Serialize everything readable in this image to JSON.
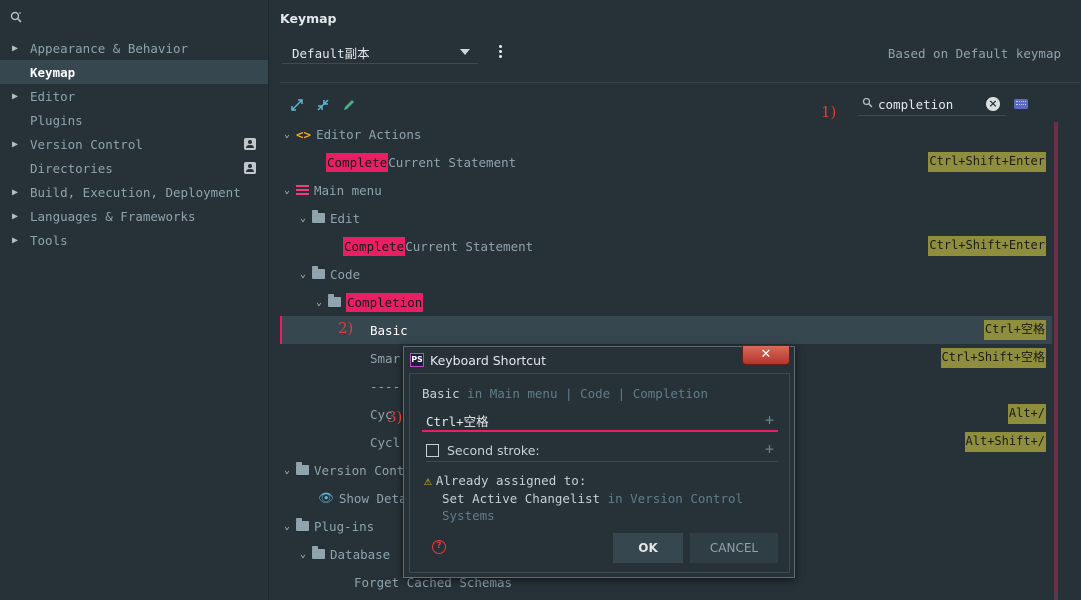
{
  "sidebar": {
    "search_icon": "search-icon",
    "items": [
      {
        "label": "Appearance & Behavior",
        "expandable": true
      },
      {
        "label": "Keymap",
        "expandable": false,
        "active": true
      },
      {
        "label": "Editor",
        "expandable": true
      },
      {
        "label": "Plugins",
        "expandable": false
      },
      {
        "label": "Version Control",
        "expandable": true,
        "badge": true
      },
      {
        "label": "Directories",
        "expandable": false,
        "badge": true
      },
      {
        "label": "Build, Execution, Deployment",
        "expandable": true
      },
      {
        "label": "Languages & Frameworks",
        "expandable": true
      },
      {
        "label": "Tools",
        "expandable": true
      }
    ]
  },
  "header": {
    "title": "Keymap",
    "keymap_value": "Default副本",
    "based_on": "Based on Default keymap"
  },
  "search": {
    "value": "completion"
  },
  "annotations": {
    "a1": "1)",
    "a2": "2)",
    "a3": "3)"
  },
  "tree": {
    "editor_actions": "Editor Actions",
    "row_complete_1": {
      "hl": "Complete",
      "rest": " Current Statement",
      "shortcut": "Ctrl+Shift+Enter"
    },
    "main_menu": "Main menu",
    "edit": "Edit",
    "row_complete_2": {
      "hl": "Complete",
      "rest": " Current Statement",
      "shortcut": "Ctrl+Shift+Enter"
    },
    "code": "Code",
    "completion": "Completion",
    "basic": {
      "label": "Basic",
      "shortcut": "Ctrl+空格"
    },
    "smart": {
      "label": "Smar",
      "shortcut": "Ctrl+Shift+空格"
    },
    "separator": "----",
    "cycle1": {
      "label": "Cyc",
      "shortcut": "Alt+/"
    },
    "cycle2": {
      "label": "Cycl",
      "shortcut": "Alt+Shift+/"
    },
    "version_control": "Version Cont",
    "show_details": "Show Deta",
    "plugins": "Plug-ins",
    "database": "Database",
    "forget_schemas": "Forget Cached Schemas"
  },
  "dialog": {
    "title": "Keyboard Shortcut",
    "close": "✕",
    "path_action": "Basic",
    "path_rest": " in Main menu | Code | Completion",
    "first_stroke": "Ctrl+空格",
    "second_stroke_label": "Second stroke:",
    "warn_line1": "Already assigned to:",
    "warn_action": "Set Active Changelist",
    "warn_in": " in Version Control Systems",
    "ok": "OK",
    "cancel": "CANCEL"
  },
  "colors": {
    "accent": "#e91e63",
    "shortcut_bg": "#8e8e3c",
    "background": "#263238"
  }
}
